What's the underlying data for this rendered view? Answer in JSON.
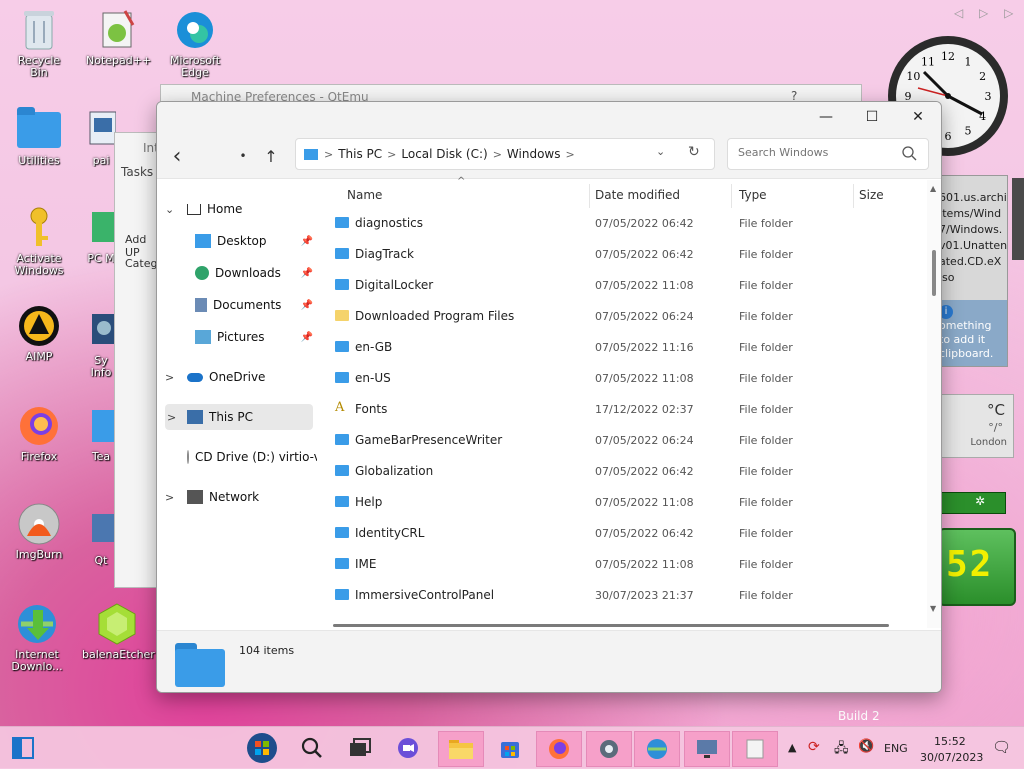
{
  "desktop": {
    "icons": [
      {
        "label": "Recycle Bin"
      },
      {
        "label": "Notepad++"
      },
      {
        "label": "Microsoft Edge"
      },
      {
        "label": "Utilities"
      },
      {
        "label": "pai"
      },
      {
        "label": "Activate Windows"
      },
      {
        "label": "PC M"
      },
      {
        "label": "AIMP"
      },
      {
        "label": "Sy Info"
      },
      {
        "label": "Firefox"
      },
      {
        "label": "Tea"
      },
      {
        "label": "ImgBurn"
      },
      {
        "label": "Qt"
      },
      {
        "label": "Internet Downlo..."
      },
      {
        "label": "balenaEtcher"
      }
    ],
    "watermark": "Build 2"
  },
  "bg_windows": {
    "qemu_title": "Machine Preferences - QtEmu",
    "qemu_help": "?",
    "inner_title": "Int",
    "tasks_label": "Tasks",
    "add_label": "Add UP",
    "categ_label": "Categ"
  },
  "explorer": {
    "controls": {
      "minimize": "—",
      "maximize": "☐",
      "close": "✕"
    },
    "nav": {
      "back": "‹",
      "dot": "•",
      "up": "↑"
    },
    "address": {
      "segments": [
        "This PC",
        "Local Disk (C:)",
        "Windows"
      ],
      "sep": ">"
    },
    "search": {
      "placeholder": "Search Windows"
    },
    "sidebar": [
      {
        "label": "Home",
        "chevron": "⌄"
      },
      {
        "label": "Desktop",
        "pin": "📌"
      },
      {
        "label": "Downloads",
        "pin": "📌"
      },
      {
        "label": "Documents",
        "pin": "📌"
      },
      {
        "label": "Pictures",
        "pin": "📌"
      },
      {
        "label": "OneDrive",
        "chevron": ">"
      },
      {
        "label": "This PC",
        "chevron": ">"
      },
      {
        "label": "CD Drive (D:) virtio-v",
        "chevron": ">"
      },
      {
        "label": "Network",
        "chevron": ">"
      }
    ],
    "columns": {
      "name": "Name",
      "date": "Date modified",
      "type": "Type",
      "size": "Size"
    },
    "rows": [
      {
        "name": "diagnostics",
        "date": "07/05/2022 06:42",
        "type": "File folder"
      },
      {
        "name": "DiagTrack",
        "date": "07/05/2022 06:42",
        "type": "File folder"
      },
      {
        "name": "DigitalLocker",
        "date": "07/05/2022 11:08",
        "type": "File folder"
      },
      {
        "name": "Downloaded Program Files",
        "date": "07/05/2022 06:24",
        "type": "File folder"
      },
      {
        "name": "en-GB",
        "date": "07/05/2022 11:16",
        "type": "File folder"
      },
      {
        "name": "en-US",
        "date": "07/05/2022 11:08",
        "type": "File folder"
      },
      {
        "name": "Fonts",
        "date": "17/12/2022 02:37",
        "type": "File folder"
      },
      {
        "name": "GameBarPresenceWriter",
        "date": "07/05/2022 06:24",
        "type": "File folder"
      },
      {
        "name": "Globalization",
        "date": "07/05/2022 06:42",
        "type": "File folder"
      },
      {
        "name": "Help",
        "date": "07/05/2022 11:08",
        "type": "File folder"
      },
      {
        "name": "IdentityCRL",
        "date": "07/05/2022 06:42",
        "type": "File folder"
      },
      {
        "name": "IME",
        "date": "07/05/2022 11:08",
        "type": "File folder"
      },
      {
        "name": "ImmersiveControlPanel",
        "date": "30/07/2023 21:37",
        "type": "File folder"
      }
    ],
    "status": {
      "count": "104 items"
    }
  },
  "gadgets": {
    "clipboard_lines": [
      "601.us.archi",
      "Items/Wind",
      "7/Windows.",
      "v01.Unatten",
      "ated.CD.eX",
      "iso"
    ],
    "clipboard_hint": [
      "omething",
      "to add it",
      "clipboard."
    ],
    "weather": {
      "deg": "°C",
      "sub": "°/°",
      "city": "London"
    },
    "led": "52",
    "clock_numbers": [
      "12",
      "1",
      "2",
      "3",
      "4",
      "5",
      "6",
      "7",
      "8",
      "9",
      "10",
      "11"
    ]
  },
  "taskbar": {
    "lang": "ENG",
    "time": "15:52",
    "date": "30/07/2023"
  },
  "colors": {
    "accent": "#3a9ce8",
    "selected": "#e5e5e5",
    "taskbar": "#f5c8e1"
  }
}
